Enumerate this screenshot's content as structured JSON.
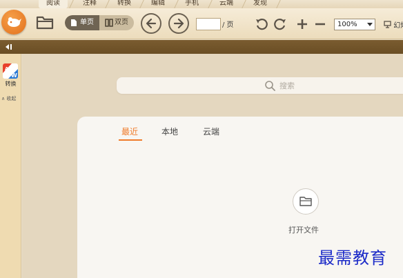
{
  "tabs": [
    "阅读",
    "注释",
    "转换",
    "编辑",
    "手机",
    "云端",
    "发现"
  ],
  "active_tab": "阅读",
  "toolbar": {
    "single_page_label": "单页",
    "double_page_label": "双页",
    "page_suffix": "/ 页",
    "page_value": "",
    "zoom_value": "100%",
    "more_label": "幻灯"
  },
  "sidebar": {
    "convert_label": "转换",
    "collapse_label": "∧ 收起"
  },
  "search": {
    "placeholder": "搜索"
  },
  "panel": {
    "tabs": [
      "最近",
      "本地",
      "云端"
    ],
    "active_tab": "最近",
    "open_file_label": "打开文件"
  },
  "watermark": "最需教育",
  "colors": {
    "accent": "#ef7b2a",
    "band": "#6a4e24",
    "sidebar": "#efdbb1",
    "watermark": "#1c2bc8"
  },
  "icons": [
    "logo-icon",
    "folder-icon",
    "page-icon",
    "double-page-icon",
    "arrow-left-icon",
    "arrow-right-icon",
    "rotate-left-icon",
    "rotate-right-icon",
    "plus-icon",
    "minus-icon",
    "slideshow-icon",
    "collapse-panel-icon",
    "convert-icon",
    "search-icon",
    "open-folder-icon"
  ]
}
